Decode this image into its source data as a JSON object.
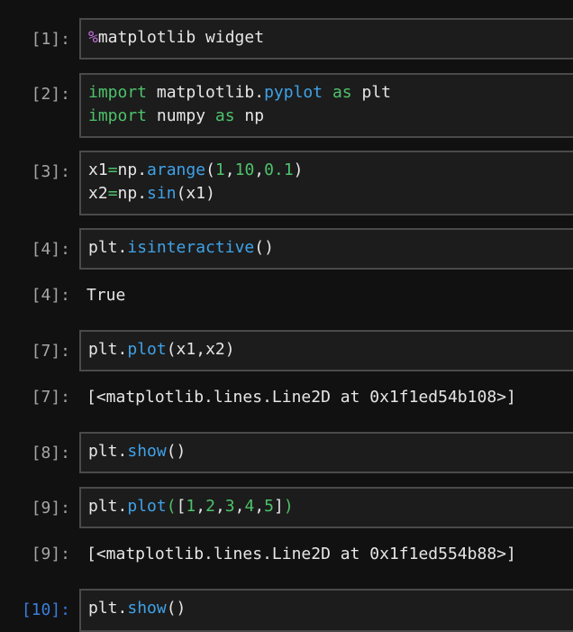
{
  "cells": [
    {
      "prompt": "[1]:",
      "lines": [
        [
          {
            "t": "%",
            "c": "mag"
          },
          {
            "t": "matplotlib widget",
            "c": "txt"
          }
        ]
      ]
    },
    {
      "prompt": "[2]:",
      "lines": [
        [
          {
            "t": "import",
            "c": "kw"
          },
          {
            "t": " matplotlib.",
            "c": "txt"
          },
          {
            "t": "pyplot",
            "c": "fn"
          },
          {
            "t": " ",
            "c": "txt"
          },
          {
            "t": "as",
            "c": "kw"
          },
          {
            "t": " plt",
            "c": "txt"
          }
        ],
        [
          {
            "t": "import",
            "c": "kw"
          },
          {
            "t": " numpy ",
            "c": "txt"
          },
          {
            "t": "as",
            "c": "kw"
          },
          {
            "t": " np",
            "c": "txt"
          }
        ]
      ]
    },
    {
      "prompt": "[3]:",
      "lines": [
        [
          {
            "t": "x1",
            "c": "txt"
          },
          {
            "t": "=",
            "c": "op"
          },
          {
            "t": "np.",
            "c": "txt"
          },
          {
            "t": "arange",
            "c": "fn"
          },
          {
            "t": "(",
            "c": "txt"
          },
          {
            "t": "1",
            "c": "num"
          },
          {
            "t": ",",
            "c": "txt"
          },
          {
            "t": "10",
            "c": "num"
          },
          {
            "t": ",",
            "c": "txt"
          },
          {
            "t": "0.1",
            "c": "num"
          },
          {
            "t": ")",
            "c": "txt"
          }
        ],
        [
          {
            "t": "x2",
            "c": "txt"
          },
          {
            "t": "=",
            "c": "op"
          },
          {
            "t": "np.",
            "c": "txt"
          },
          {
            "t": "sin",
            "c": "fn"
          },
          {
            "t": "(x1)",
            "c": "txt"
          }
        ]
      ]
    },
    {
      "prompt": "[4]:",
      "lines": [
        [
          {
            "t": "plt.",
            "c": "txt"
          },
          {
            "t": "isinteractive",
            "c": "fn"
          },
          {
            "t": "()",
            "c": "txt"
          }
        ]
      ],
      "output_prompt": "[4]:",
      "output": "True"
    },
    {
      "prompt": "[7]:",
      "lines": [
        [
          {
            "t": "plt.",
            "c": "txt"
          },
          {
            "t": "plot",
            "c": "fn"
          },
          {
            "t": "(x1,x2)",
            "c": "txt"
          }
        ]
      ],
      "output_prompt": "[7]:",
      "output": "[<matplotlib.lines.Line2D at 0x1f1ed54b108>]"
    },
    {
      "prompt": "[8]:",
      "lines": [
        [
          {
            "t": "plt.",
            "c": "txt"
          },
          {
            "t": "show",
            "c": "fn"
          },
          {
            "t": "()",
            "c": "txt"
          }
        ]
      ]
    },
    {
      "prompt": "[9]:",
      "lines": [
        [
          {
            "t": "plt.",
            "c": "txt"
          },
          {
            "t": "plot",
            "c": "fn"
          },
          {
            "t": "(",
            "c": "num"
          },
          {
            "t": "[",
            "c": "txt"
          },
          {
            "t": "1",
            "c": "num"
          },
          {
            "t": ",",
            "c": "txt"
          },
          {
            "t": "2",
            "c": "num"
          },
          {
            "t": ",",
            "c": "txt"
          },
          {
            "t": "3",
            "c": "num"
          },
          {
            "t": ",",
            "c": "txt"
          },
          {
            "t": "4",
            "c": "num"
          },
          {
            "t": ",",
            "c": "txt"
          },
          {
            "t": "5",
            "c": "num"
          },
          {
            "t": "]",
            "c": "txt"
          },
          {
            "t": ")",
            "c": "num"
          }
        ]
      ],
      "output_prompt": "[9]:",
      "output": "[<matplotlib.lines.Line2D at 0x1f1ed554b88>]"
    },
    {
      "prompt": "[10]:",
      "active": true,
      "lines": [
        [
          {
            "t": "plt.",
            "c": "txt"
          },
          {
            "t": "show",
            "c": "fn"
          },
          {
            "t": "()",
            "c": "txt"
          }
        ]
      ]
    }
  ],
  "colors": {
    "background": "#111111",
    "cell_background": "#1c1c1c",
    "cell_border": "#4a4a4a",
    "prompt": "#a6a6a6",
    "prompt_active": "#3b7ddd",
    "keyword_green": "#4ec26b",
    "function_blue": "#3fa2e8",
    "magic_purple": "#c26ee0",
    "text": "#e6e6e6"
  }
}
